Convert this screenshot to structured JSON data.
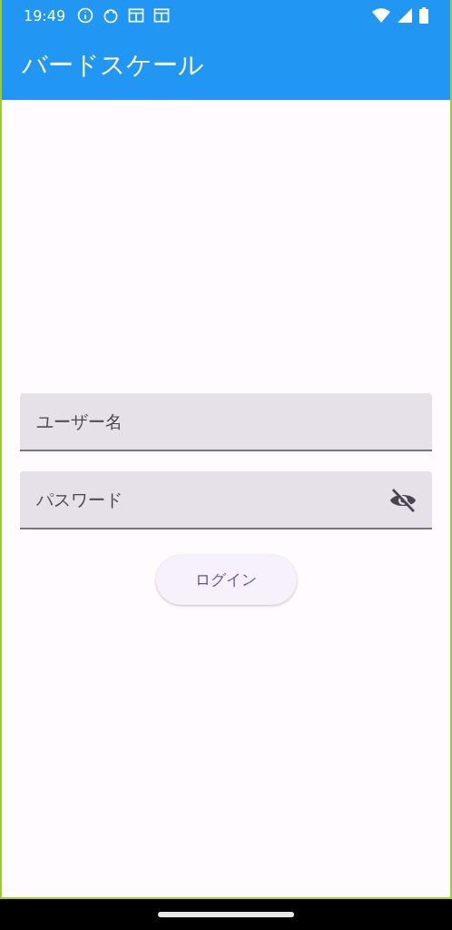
{
  "status_bar": {
    "time": "19:49"
  },
  "app_bar": {
    "title": "バードスケール"
  },
  "fields": [
    {
      "placeholder": "ユーザー名",
      "kind": "text"
    },
    {
      "placeholder": "パスワード",
      "kind": "password",
      "obscured": true
    }
  ],
  "button": {
    "label": "ログイン"
  }
}
